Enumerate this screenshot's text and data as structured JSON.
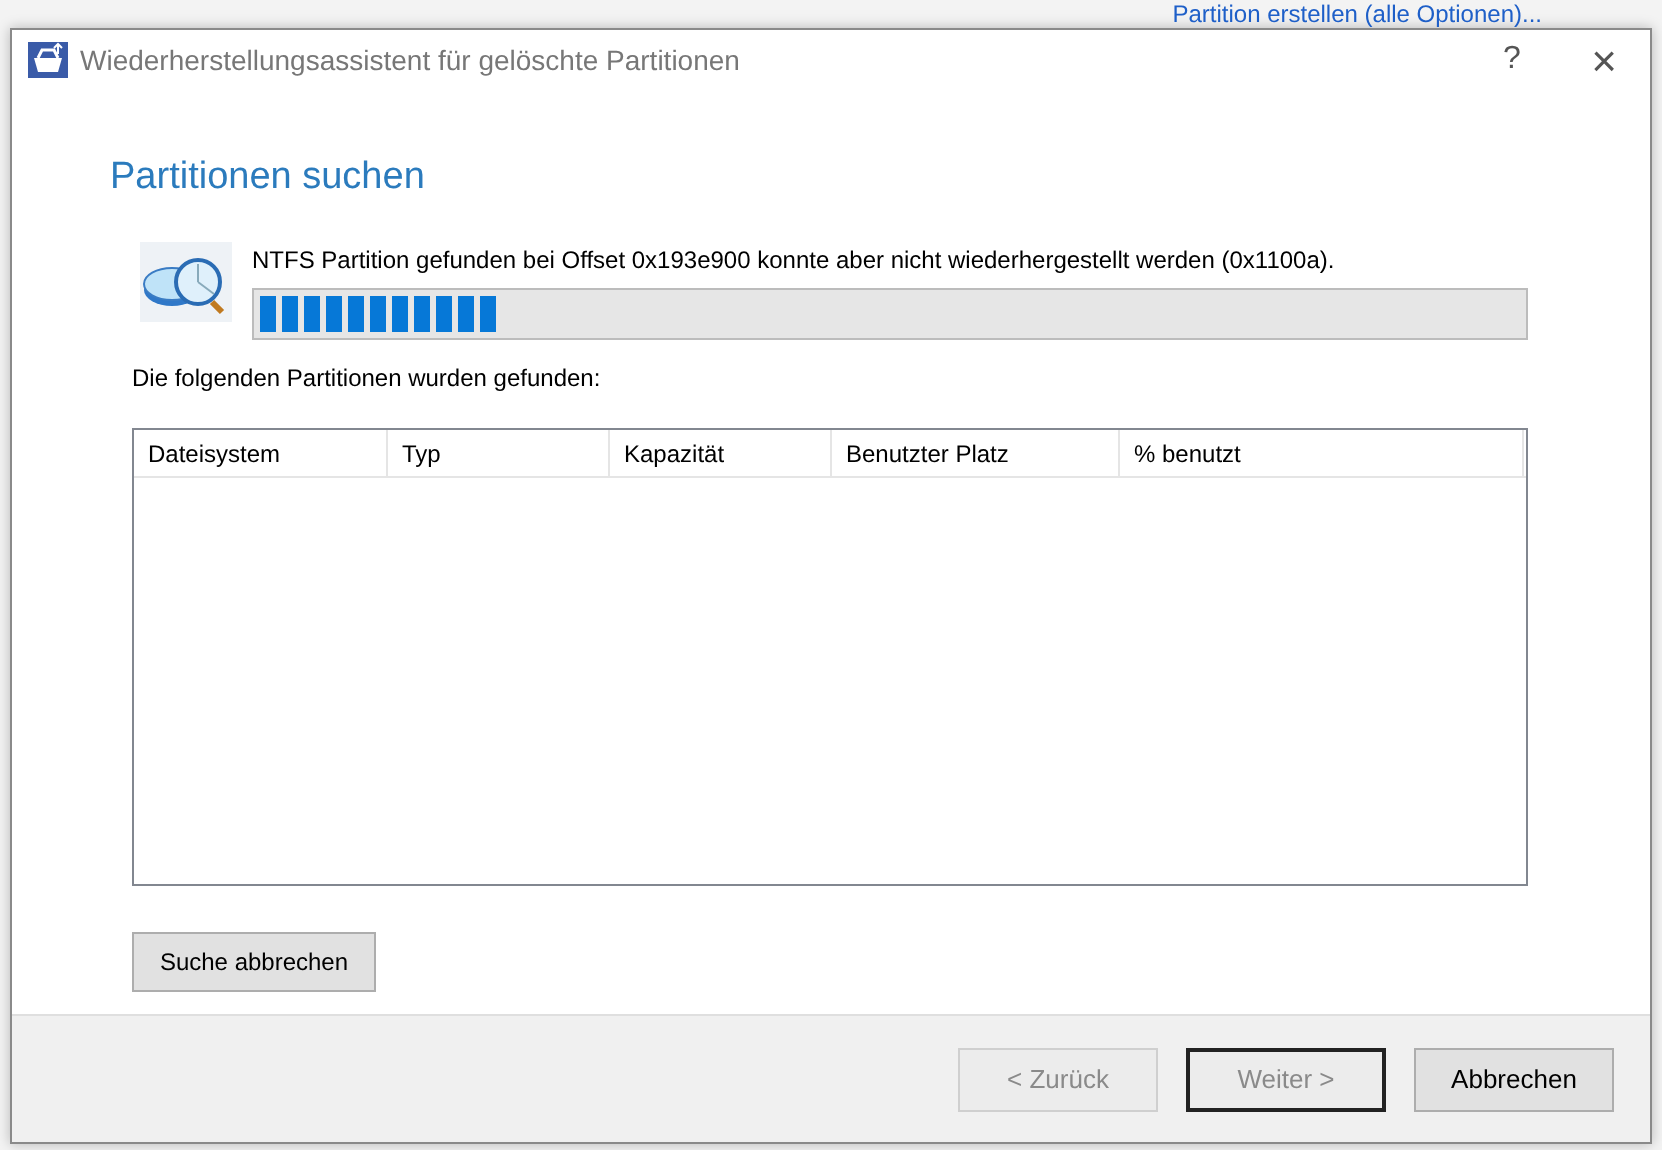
{
  "background": {
    "link": "Partition erstellen (alle Optionen)..."
  },
  "window": {
    "title": "Wiederherstellungsassistent für gelöschte Partitionen",
    "help": "?",
    "close": "×"
  },
  "heading": "Partitionen suchen",
  "status": {
    "message": "NTFS Partition gefunden bei Offset 0x193e900 konnte aber nicht wiederhergestellt werden (0x1100a).",
    "level": 0.19
  },
  "list_label": "Die folgenden Partitionen wurden gefunden:",
  "table": {
    "columns": [
      "Dateisystem",
      "Typ",
      "Kapazität",
      "Benutzter Platz",
      "% benutzt"
    ]
  },
  "stop_button": "Suche abbrechen",
  "buttons": [
    {
      "label": "< Zurück",
      "disabled": true,
      "default": false
    },
    {
      "label": "Weiter >",
      "disabled": true,
      "default": true
    },
    {
      "label": "Abbrechen",
      "disabled": false,
      "default": false
    }
  ]
}
